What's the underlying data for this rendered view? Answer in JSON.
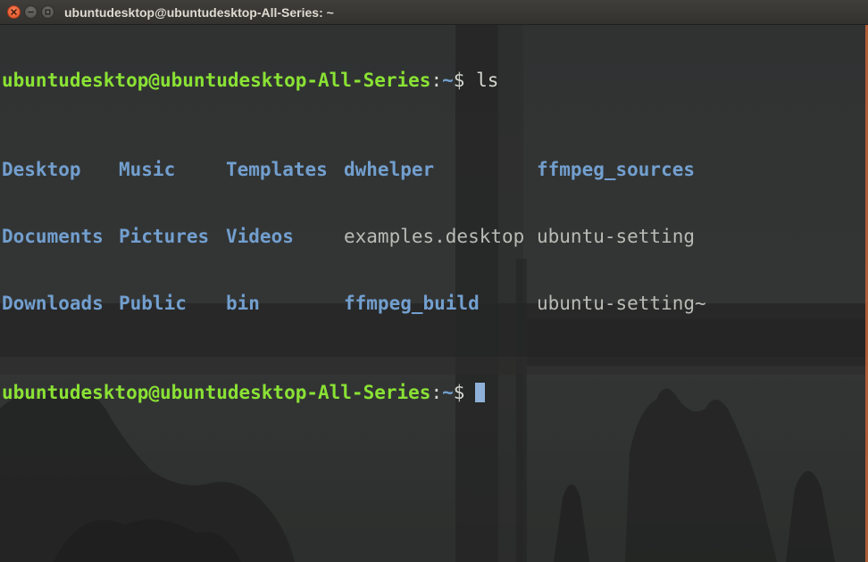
{
  "window": {
    "title": "ubuntudesktop@ubuntudesktop-All-Series: ~",
    "buttons": {
      "close": "close",
      "minimize": "minimize",
      "maximize": "maximize"
    }
  },
  "terminal": {
    "prompt": {
      "user_host": "ubuntudesktop@ubuntudesktop-All-Series",
      "colon": ":",
      "path": "~",
      "symbol": "$"
    },
    "command": "ls",
    "listing": [
      [
        "Desktop",
        "Music",
        "Templates",
        "dwhelper",
        "ffmpeg_sources"
      ],
      [
        "Documents",
        "Pictures",
        "Videos",
        "examples.desktop",
        "ubuntu-setting"
      ],
      [
        "Downloads",
        "Public",
        "bin",
        "ffmpeg_build",
        "ubuntu-setting~"
      ]
    ],
    "colors": {
      "prompt_user": "#8ae234",
      "prompt_path": "#729fcf",
      "directory": "#729fcf",
      "file": "#b8bcb5",
      "cursor": "#8fb0d8"
    }
  }
}
